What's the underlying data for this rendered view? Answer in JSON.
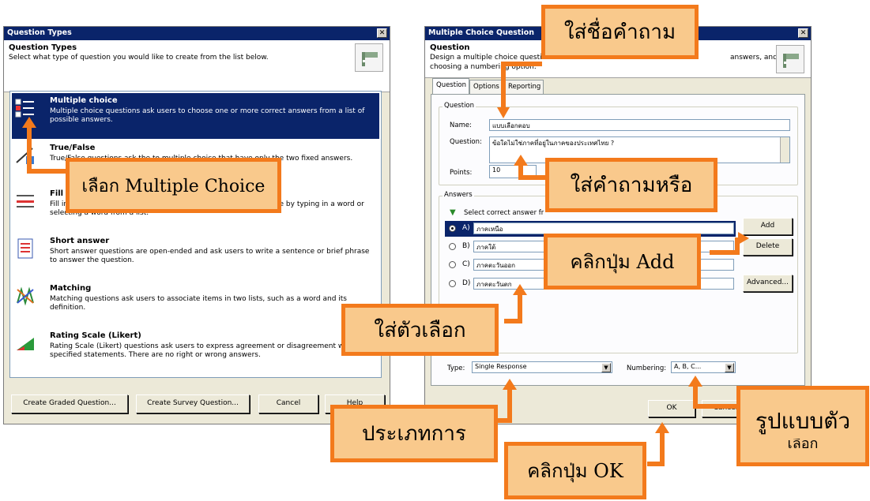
{
  "left_dialog": {
    "title": "Question Types",
    "header_title": "Question Types",
    "header_sub": "Select what type of question you would like to create from the list below.",
    "items": [
      {
        "title": "Multiple choice",
        "desc": "Multiple choice questions ask users to choose one or more correct answers from a list of possible answers.",
        "selected": true
      },
      {
        "title": "True/False",
        "desc": "True/False questions ask the to multiple choice that have only the two fixed answers.",
        "selected": false
      },
      {
        "title": "Fill in the blank",
        "desc": "Fill in the blank questions ask users to complete a word or phrase by typing in a word or selecting a word from a list.",
        "selected": false
      },
      {
        "title": "Short answer",
        "desc": "Short answer questions are open-ended and ask users to write a sentence or brief phrase to answer the question.",
        "selected": false
      },
      {
        "title": "Matching",
        "desc": "Matching questions ask users to associate items in two lists, such as a word and its definition.",
        "selected": false
      },
      {
        "title": "Rating Scale (Likert)",
        "desc": "Rating Scale (Likert) questions ask users to express agreement or disagreement with specified statements. There are no right or wrong answers.",
        "selected": false
      }
    ],
    "buttons": {
      "graded": "Create Graded Question...",
      "survey": "Create Survey Question...",
      "cancel": "Cancel",
      "help": "Help"
    }
  },
  "right_dialog": {
    "title": "Multiple Choice Question",
    "header_title": "Question",
    "header_sub_1": "Design a multiple choice question",
    "header_sub_1b": "answers, and",
    "header_sub_2": "choosing a numbering option.",
    "tabs": [
      "Question",
      "Options",
      "Reporting"
    ],
    "question_group": "Question",
    "name_label": "Name:",
    "name_value": "แบบเลือกตอบ",
    "question_label": "Question:",
    "question_value": "ข้อใดไม่ใช่ภาคที่อยู่ในภาคของประเทศไทย ?",
    "points_label": "Points:",
    "points_value": "10",
    "answers_group": "Answers",
    "answers_hint": "Select correct answer fr",
    "answers": [
      {
        "letter": "A)",
        "text": "ภาคเหนือ",
        "selected": true
      },
      {
        "letter": "B)",
        "text": "ภาคใต้",
        "selected": false
      },
      {
        "letter": "C)",
        "text": "ภาคตะวันออก",
        "selected": false
      },
      {
        "letter": "D)",
        "text": "ภาคตะวันตก",
        "selected": false
      }
    ],
    "buttons": {
      "add": "Add",
      "delete": "Delete",
      "advanced": "Advanced...",
      "ok": "OK",
      "cancel": "Cancel"
    },
    "type_label": "Type:",
    "type_value": "Single Response",
    "numbering_label": "Numbering:",
    "numbering_value": "A, B, C..."
  },
  "callouts": {
    "choose_mc": "เลือก Multiple Choice",
    "name": "ใส่ชื่อคำถาม",
    "question": "ใส่คำถามหรือ",
    "add": "คลิกปุ่ม Add",
    "choices": "ใส่ตัวเลือก",
    "type": "ประเภทการ",
    "format": "รูปแบบตัว",
    "format_2": "เลือก",
    "ok": "คลิกปุ่ม OK"
  },
  "colors": {
    "accent": "#f37a1c",
    "callout_fill": "#f9c98c",
    "titlebar": "#0a246a"
  }
}
